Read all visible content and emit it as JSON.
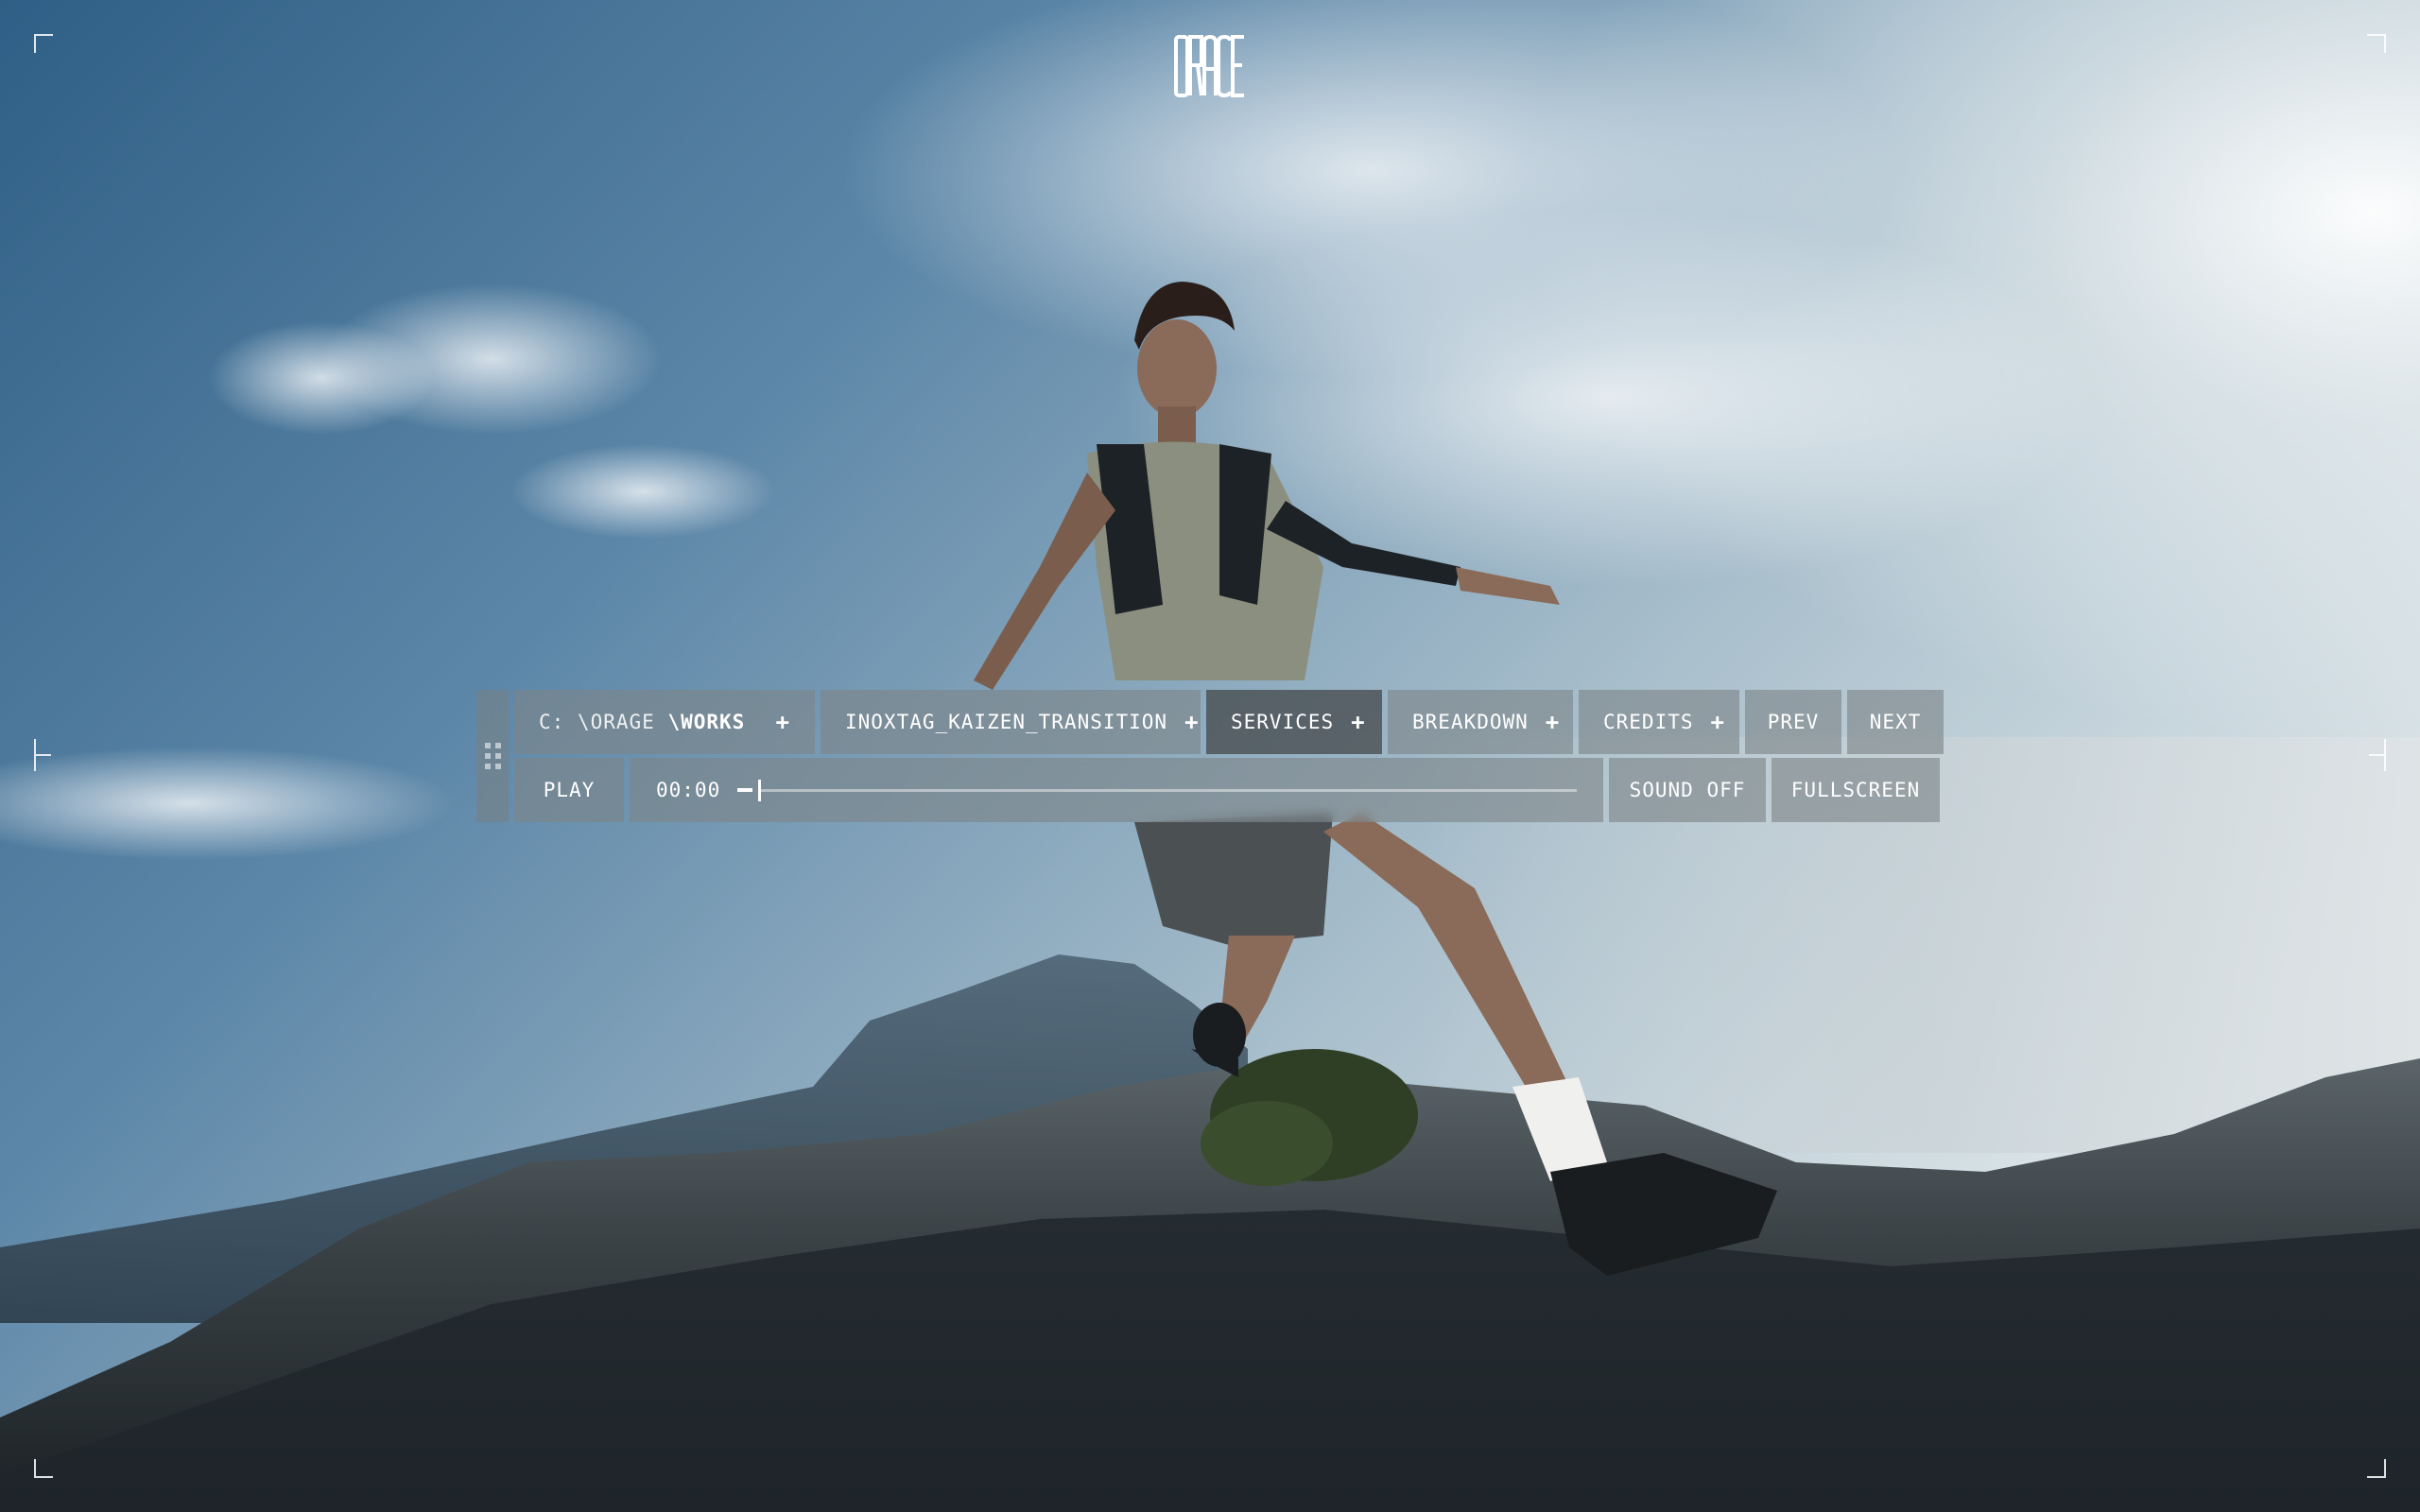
{
  "brand": {
    "logo_text": "ORACE"
  },
  "nav": {
    "path_prefix": "C: \\ORAGE",
    "path_current": "\\WORKS",
    "project": "INOXTAG_KAIZEN_TRANSITION",
    "services": "SERVICES",
    "breakdown": "BREAKDOWN",
    "credits": "CREDITS",
    "plus": "+",
    "prev": "PREV",
    "next": "NEXT"
  },
  "player": {
    "play_label": "PLAY",
    "time": "00:00",
    "progress": 0.0,
    "sound_label": "SOUND OFF",
    "fullscreen_label": "FULLSCREEN"
  },
  "icons": {
    "drag_handle": "drag-handle-icon",
    "plus": "plus-icon"
  }
}
